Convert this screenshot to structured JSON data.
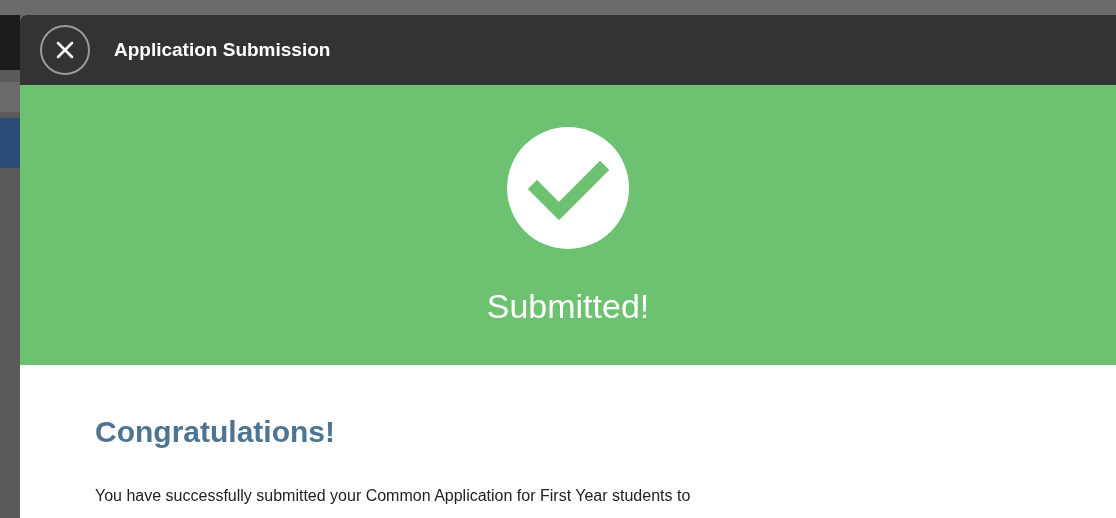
{
  "dialog": {
    "title": "Application Submission"
  },
  "banner": {
    "status": "Submitted!"
  },
  "body": {
    "heading": "Congratulations!",
    "message": "You have successfully submitted your Common Application for First Year students to"
  }
}
